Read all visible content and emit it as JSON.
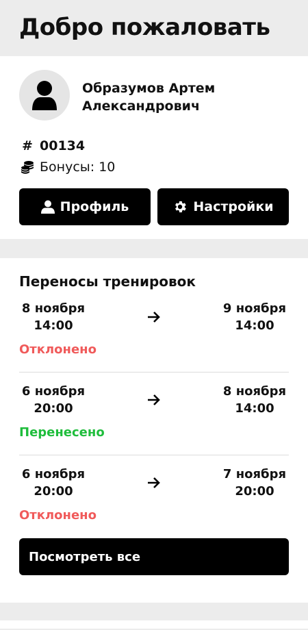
{
  "header": {
    "title": "Добро пожаловать"
  },
  "profile": {
    "avatar_icon": "user-icon",
    "name_line1": "Образумов Артем",
    "name_line2": "Александрович",
    "id_symbol": "#",
    "id": "00134",
    "bonus_icon": "coins-icon",
    "bonus_label": "Бонусы: 10",
    "buttons": {
      "profile_label": "Профиль",
      "profile_icon": "user-icon",
      "settings_label": "Настройки",
      "settings_icon": "gear-icon"
    }
  },
  "transfers": {
    "title": "Переносы тренировок",
    "items": [
      {
        "from_date": "8 ноября",
        "from_time": "14:00",
        "to_date": "9 ноября",
        "to_time": "14:00",
        "status": "Отклонено",
        "status_type": "rejected"
      },
      {
        "from_date": "6 ноября",
        "from_time": "20:00",
        "to_date": "8 ноября",
        "to_time": "14:00",
        "status": "Перенесено",
        "status_type": "moved"
      },
      {
        "from_date": "6 ноября",
        "from_time": "20:00",
        "to_date": "7 ноября",
        "to_time": "20:00",
        "status": "Отклонено",
        "status_type": "rejected"
      }
    ],
    "view_all_label": "Посмотреть все"
  },
  "colors": {
    "rejected": "#f05a5a",
    "moved": "#1fbd3c",
    "button_bg": "#000000",
    "page_bg": "#ececec"
  }
}
